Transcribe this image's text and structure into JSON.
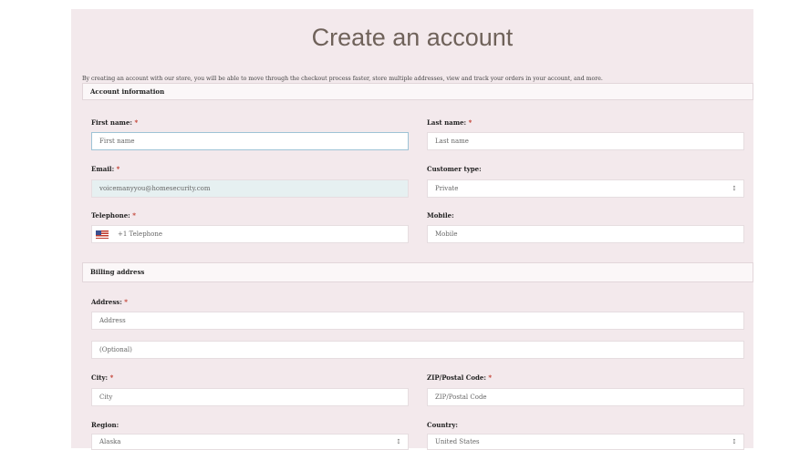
{
  "page": {
    "title": "Create an account",
    "intro": "By creating an account with our store, you will be able to move through the checkout process faster, store multiple addresses, view and track your orders in your account, and more."
  },
  "account_section": {
    "heading": "Account information",
    "first_name": {
      "label": "First name:",
      "required": "*",
      "placeholder": "First name",
      "value": ""
    },
    "last_name": {
      "label": "Last name:",
      "required": "*",
      "placeholder": "Last name",
      "value": ""
    },
    "email": {
      "label": "Email:",
      "required": "*",
      "value": "voicemanyyou@homesecurity.com"
    },
    "customer_type": {
      "label": "Customer type:",
      "selected": "Private"
    },
    "telephone": {
      "label": "Telephone:",
      "required": "*",
      "placeholder": "+1 Telephone"
    },
    "mobile": {
      "label": "Mobile:",
      "placeholder": "Mobile"
    }
  },
  "billing_section": {
    "heading": "Billing address",
    "address": {
      "label": "Address:",
      "required": "*",
      "placeholder": "Address",
      "placeholder2": "(Optional)"
    },
    "city": {
      "label": "City:",
      "required": "*",
      "placeholder": "City"
    },
    "zip": {
      "label": "ZIP/Postal Code:",
      "required": "*",
      "placeholder": "ZIP/Postal Code"
    },
    "region": {
      "label": "Region:",
      "selected": "Alaska"
    },
    "country": {
      "label": "Country:",
      "selected": "United States"
    }
  },
  "icons": {
    "select_chevron": "chevron-updown-icon",
    "flag": "us-flag-icon"
  },
  "colors": {
    "background": "#f3e9ec",
    "required": "#c0392b",
    "focus_border": "#9ec3d6",
    "autofill": "#e6f0f1"
  }
}
